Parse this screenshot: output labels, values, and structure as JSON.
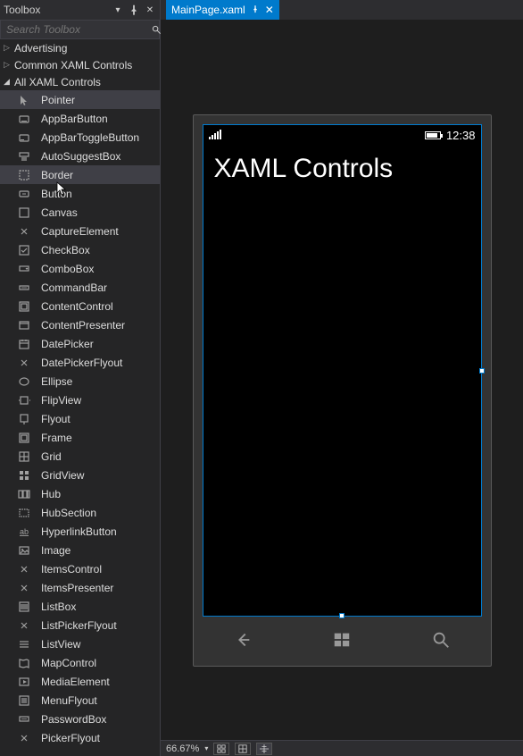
{
  "toolbox": {
    "title": "Toolbox",
    "search_placeholder": "Search Toolbox",
    "categories": [
      {
        "label": "Advertising",
        "expanded": false
      },
      {
        "label": "Common XAML Controls",
        "expanded": false
      },
      {
        "label": "All XAML Controls",
        "expanded": true
      }
    ],
    "items": [
      {
        "label": "Pointer",
        "icon": "pointer"
      },
      {
        "label": "AppBarButton",
        "icon": "appbarbutton"
      },
      {
        "label": "AppBarToggleButton",
        "icon": "appbartoggle"
      },
      {
        "label": "AutoSuggestBox",
        "icon": "autosuggest"
      },
      {
        "label": "Border",
        "icon": "border"
      },
      {
        "label": "Button",
        "icon": "button"
      },
      {
        "label": "Canvas",
        "icon": "canvas"
      },
      {
        "label": "CaptureElement",
        "icon": "capture"
      },
      {
        "label": "CheckBox",
        "icon": "checkbox"
      },
      {
        "label": "ComboBox",
        "icon": "combobox"
      },
      {
        "label": "CommandBar",
        "icon": "commandbar"
      },
      {
        "label": "ContentControl",
        "icon": "content"
      },
      {
        "label": "ContentPresenter",
        "icon": "presenter"
      },
      {
        "label": "DatePicker",
        "icon": "datepicker"
      },
      {
        "label": "DatePickerFlyout",
        "icon": "capture"
      },
      {
        "label": "Ellipse",
        "icon": "ellipse"
      },
      {
        "label": "FlipView",
        "icon": "flipview"
      },
      {
        "label": "Flyout",
        "icon": "flyout"
      },
      {
        "label": "Frame",
        "icon": "frame"
      },
      {
        "label": "Grid",
        "icon": "grid"
      },
      {
        "label": "GridView",
        "icon": "gridview"
      },
      {
        "label": "Hub",
        "icon": "hub"
      },
      {
        "label": "HubSection",
        "icon": "hubsection"
      },
      {
        "label": "HyperlinkButton",
        "icon": "hyperlink"
      },
      {
        "label": "Image",
        "icon": "image"
      },
      {
        "label": "ItemsControl",
        "icon": "capture"
      },
      {
        "label": "ItemsPresenter",
        "icon": "capture"
      },
      {
        "label": "ListBox",
        "icon": "listbox"
      },
      {
        "label": "ListPickerFlyout",
        "icon": "capture"
      },
      {
        "label": "ListView",
        "icon": "listview"
      },
      {
        "label": "MapControl",
        "icon": "map"
      },
      {
        "label": "MediaElement",
        "icon": "media"
      },
      {
        "label": "MenuFlyout",
        "icon": "menuflyout"
      },
      {
        "label": "PasswordBox",
        "icon": "password"
      },
      {
        "label": "PickerFlyout",
        "icon": "capture"
      }
    ],
    "selected_index": 0,
    "hover_index": 4
  },
  "editor": {
    "tab_label": "MainPage.xaml",
    "page_title": "XAML Controls",
    "clock": "12:38",
    "zoom": "66.67%"
  }
}
